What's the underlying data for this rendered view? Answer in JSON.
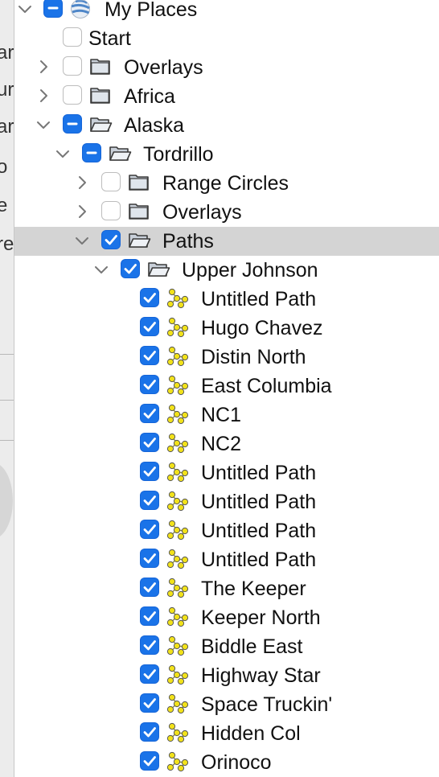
{
  "left_pane": {
    "fragments": [
      "ar",
      "ur",
      "ar",
      "o",
      "e",
      "re"
    ]
  },
  "tree": {
    "root": {
      "label": "My Places",
      "state": "mixed",
      "icon": "globe-icon"
    },
    "items": [
      {
        "label": "Start",
        "state": "off",
        "icon": "none",
        "chevron": "none"
      },
      {
        "label": "Overlays",
        "state": "off",
        "icon": "folder-closed-icon",
        "chevron": "right"
      },
      {
        "label": "Africa",
        "state": "off",
        "icon": "folder-closed-icon",
        "chevron": "right"
      },
      {
        "label": "Alaska",
        "state": "mixed",
        "icon": "folder-open-icon",
        "chevron": "down"
      },
      {
        "label": "Tordrillo",
        "state": "mixed",
        "icon": "folder-open-icon",
        "chevron": "down"
      },
      {
        "label": "Range Circles",
        "state": "off",
        "icon": "folder-closed-icon",
        "chevron": "right"
      },
      {
        "label": "Overlays",
        "state": "off",
        "icon": "folder-closed-icon",
        "chevron": "right"
      },
      {
        "label": "Paths",
        "state": "on",
        "icon": "folder-open-icon",
        "chevron": "down",
        "selected": true
      },
      {
        "label": "Upper Johnson",
        "state": "on",
        "icon": "folder-open-icon",
        "chevron": "down"
      }
    ],
    "paths": [
      "Untitled Path",
      "Hugo Chavez",
      "Distin North",
      "East Columbia",
      "NC1",
      "NC2",
      "Untitled Path",
      "Untitled Path",
      "Untitled Path",
      "Untitled Path",
      "The Keeper",
      "Keeper North",
      "Biddle East",
      "Highway Star",
      "Space Truckin'",
      "Hidden Col",
      "Orinoco"
    ]
  },
  "colors": {
    "checkbox_blue": "#1a73e8",
    "selection_gray": "#d4d4d4",
    "path_node_yellow": "#f2e21a"
  }
}
